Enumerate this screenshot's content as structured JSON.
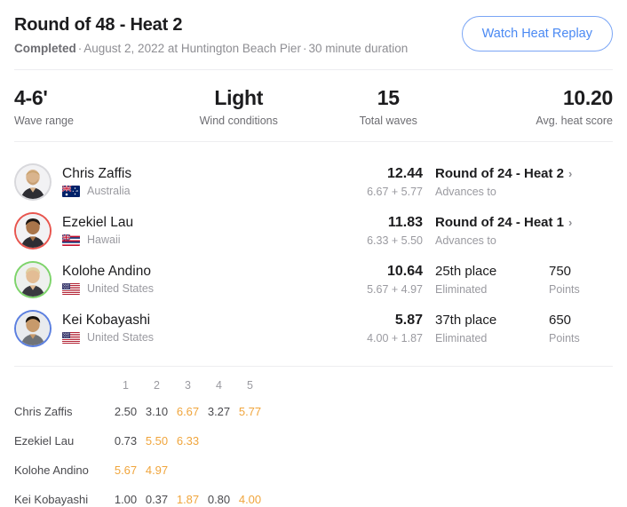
{
  "header": {
    "title": "Round of 48 - Heat 2",
    "status": "Completed",
    "separator": "·",
    "date_location": "August 2, 2022 at Huntington Beach Pier",
    "duration": "30 minute duration",
    "replay_button": "Watch Heat Replay"
  },
  "stats": [
    {
      "value": "4-6'",
      "label": "Wave range"
    },
    {
      "value": "Light",
      "label": "Wind conditions"
    },
    {
      "value": "15",
      "label": "Total waves"
    },
    {
      "value": "10.20",
      "label": "Avg. heat score"
    }
  ],
  "surfers": [
    {
      "name": "Chris Zaffis",
      "country": "Australia",
      "flag": "flag-australia",
      "jersey_color": "#d8d8dc",
      "total": "12.44",
      "breakdown": "6.67 + 5.77",
      "result": "Round of 24 - Heat 2",
      "result_sub": "Advances to",
      "has_chevron": true,
      "points": "",
      "points_label": ""
    },
    {
      "name": "Ezekiel Lau",
      "country": "Hawaii",
      "flag": "flag-hawaii",
      "jersey_color": "#e8554e",
      "total": "11.83",
      "breakdown": "6.33 + 5.50",
      "result": "Round of 24 - Heat 1",
      "result_sub": "Advances to",
      "has_chevron": true,
      "points": "",
      "points_label": ""
    },
    {
      "name": "Kolohe Andino",
      "country": "United States",
      "flag": "flag-united-states",
      "jersey_color": "#7dd46a",
      "total": "10.64",
      "breakdown": "5.67 + 4.97",
      "result": "25th place",
      "result_sub": "Eliminated",
      "has_chevron": false,
      "points": "750",
      "points_label": "Points"
    },
    {
      "name": "Kei Kobayashi",
      "country": "United States",
      "flag": "flag-united-states",
      "jersey_color": "#5b7fe0",
      "total": "5.87",
      "breakdown": "4.00 + 1.87",
      "result": "37th place",
      "result_sub": "Eliminated",
      "has_chevron": false,
      "points": "650",
      "points_label": "Points"
    }
  ],
  "wave_table": {
    "columns": [
      "1",
      "2",
      "3",
      "4",
      "5"
    ],
    "rows": [
      {
        "name": "Chris Zaffis",
        "scores": [
          "2.50",
          "3.10",
          "6.67",
          "3.27",
          "5.77"
        ],
        "counted": [
          false,
          false,
          true,
          false,
          true
        ]
      },
      {
        "name": "Ezekiel Lau",
        "scores": [
          "0.73",
          "5.50",
          "6.33",
          "",
          ""
        ],
        "counted": [
          false,
          true,
          true,
          false,
          false
        ]
      },
      {
        "name": "Kolohe Andino",
        "scores": [
          "5.67",
          "4.97",
          "",
          "",
          ""
        ],
        "counted": [
          true,
          true,
          false,
          false,
          false
        ]
      },
      {
        "name": "Kei Kobayashi",
        "scores": [
          "1.00",
          "0.37",
          "1.87",
          "0.80",
          "4.00"
        ],
        "counted": [
          false,
          false,
          true,
          false,
          true
        ]
      }
    ]
  },
  "colors": {
    "accent_blue": "#4a89f3",
    "counted_orange": "#f0a53c",
    "text_primary": "#1c1c1e",
    "text_muted": "#9a9aa0"
  },
  "icons": {
    "chevron_right": "›"
  }
}
